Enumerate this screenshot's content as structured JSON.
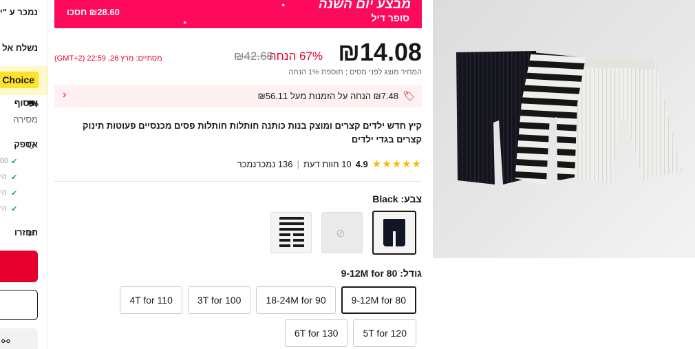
{
  "sidebar": {
    "sold_by": "נמכר ע \"י",
    "ships_to": "נשלח אל",
    "choice_badge": "Choice",
    "collection_title": "איסוף",
    "collection_sub": "מסירה",
    "spec_title": "אספק",
    "spec_checks": [
      "00",
      "הי",
      "הי",
      "הי"
    ],
    "returns_title": "החזרו"
  },
  "banner": {
    "title": "מבצע יום השנה",
    "subtitle": "סופר דיל",
    "savings": "₪28.60 חסכו"
  },
  "price": {
    "current": "₪14.08",
    "original": "₪42.68",
    "discount": "67% הנחה",
    "ends": "מסתיים: מרץ 26, 22:59 (GMT+2)",
    "tax_note": "המחיר מוצג לפני מסים ; תוספת 1% הנחה"
  },
  "coupon": {
    "text": "₪7.48 הנחה על הזמנות מעל ₪56.11"
  },
  "product": {
    "title": "קיץ חדש ילדים קצרים ומוצק בנות כותנה חותלות חותלות פסים מכנסיים פעוטות תינוק קצרים בגדי ילדים"
  },
  "rating": {
    "stars": "★★★★★",
    "score": "4.9",
    "reviews": "10 חוות דעת",
    "sold": "136 נמכרנמכר"
  },
  "color": {
    "label": "צבע:",
    "selected": "Black"
  },
  "size": {
    "label": "גודל:",
    "selected": "80 9-12M for",
    "options": [
      "80 9-12M for",
      "90 18-24M for",
      "100 3T for",
      "110 4T for",
      "120 5T for",
      "130 6T for"
    ]
  }
}
